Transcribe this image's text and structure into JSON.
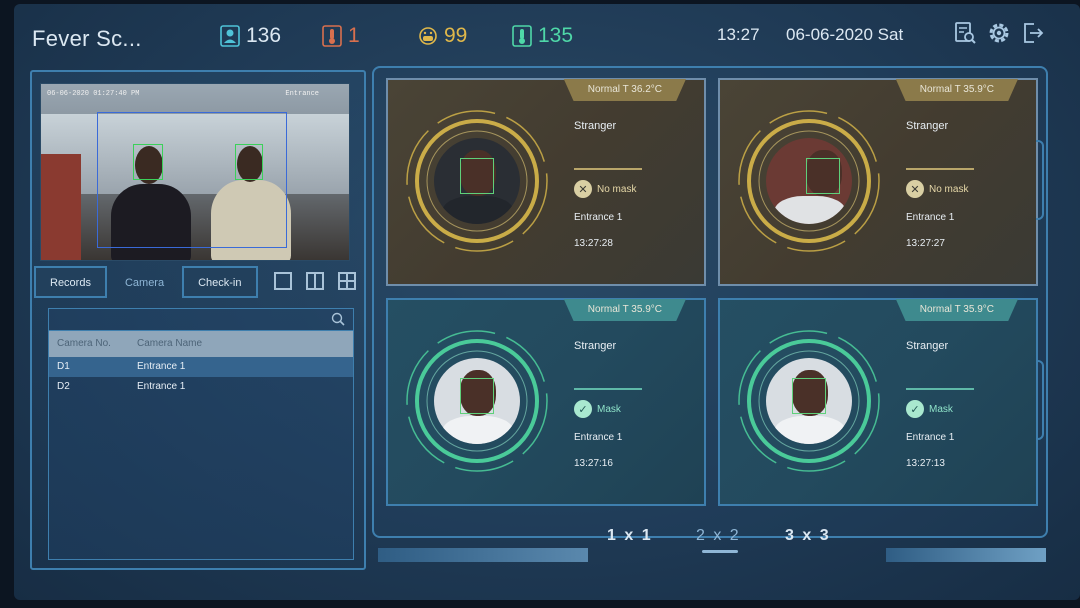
{
  "header": {
    "title": "Fever Sc...",
    "stats": [
      {
        "icon": "person-icon",
        "value": "136",
        "color": "#4fc3d8"
      },
      {
        "icon": "thermometer-alert-icon",
        "value": "1",
        "color": "#d9704e"
      },
      {
        "icon": "mask-face-icon",
        "value": "99",
        "color": "#e0b84a"
      },
      {
        "icon": "thermometer-icon",
        "value": "135",
        "color": "#4fd8a8"
      }
    ],
    "time": "13:27",
    "date": "06-06-2020 Sat"
  },
  "camera_preview": {
    "osd_datetime": "06-06-2020 01:27:40 PM",
    "osd_name": "Entrance"
  },
  "left_tabs": [
    "Records",
    "Camera",
    "Check-in"
  ],
  "camera_list": {
    "search_placeholder": "",
    "headers": [
      "Camera No.",
      "Camera Name"
    ],
    "rows": [
      {
        "no": "D1",
        "name": "Entrance 1"
      },
      {
        "no": "D2",
        "name": "Entrance 1"
      }
    ]
  },
  "cards": [
    {
      "status": "warn",
      "temp": "Normal T 36.2°C",
      "who": "Stranger",
      "mask": "No mask",
      "location": "Entrance 1",
      "time": "13:27:28"
    },
    {
      "status": "warn",
      "temp": "Normal T 35.9°C",
      "who": "Stranger",
      "mask": "No mask",
      "location": "Entrance 1",
      "time": "13:27:27"
    },
    {
      "status": "ok",
      "temp": "Normal T 35.9°C",
      "who": "Stranger",
      "mask": "Mask",
      "location": "Entrance 1",
      "time": "13:27:16"
    },
    {
      "status": "ok",
      "temp": "Normal T 35.9°C",
      "who": "Stranger",
      "mask": "Mask",
      "location": "Entrance 1",
      "time": "13:27:13"
    }
  ],
  "grid_options": [
    "1 x 1",
    "2 x 2",
    "3 x 3"
  ],
  "colors": {
    "accent": "#3e7fae",
    "warn_ring": "#d8b84a",
    "ok_ring": "#4fd8a0"
  }
}
